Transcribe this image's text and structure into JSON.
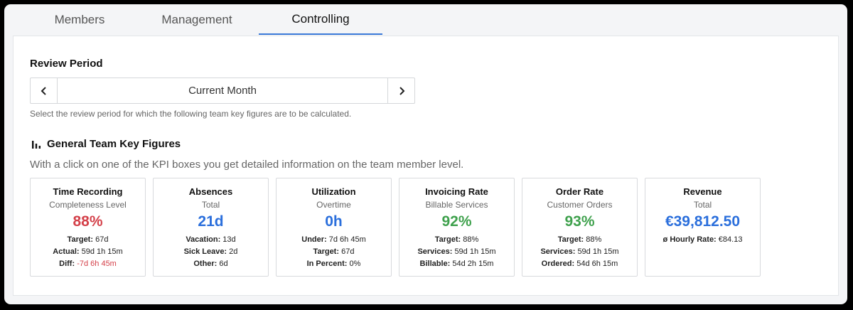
{
  "tabs": [
    {
      "label": "Members",
      "active": false
    },
    {
      "label": "Management",
      "active": false
    },
    {
      "label": "Controlling",
      "active": true
    }
  ],
  "review_period": {
    "title": "Review Period",
    "value": "Current Month",
    "help": "Select the review period for which the following team key figures are to be calculated."
  },
  "kpi": {
    "title": "General Team Key Figures",
    "description": "With a click on one of the KPI boxes you get detailed information on the team member level.",
    "cards": [
      {
        "title": "Time Recording",
        "subtitle": "Completeness Level",
        "value": "88%",
        "color": "#d4414a",
        "lines": [
          {
            "label": "Target:",
            "value": "67d"
          },
          {
            "label": "Actual:",
            "value": "59d 1h 15m"
          },
          {
            "label": "Diff:",
            "value": "-7d 6h 45m"
          }
        ]
      },
      {
        "title": "Absences",
        "subtitle": "Total",
        "value": "21d",
        "color": "#2b6fdc",
        "lines": [
          {
            "label": "Vacation:",
            "value": "13d"
          },
          {
            "label": "Sick Leave:",
            "value": "2d"
          },
          {
            "label": "Other:",
            "value": "6d"
          }
        ]
      },
      {
        "title": "Utilization",
        "subtitle": "Overtime",
        "value": "0h",
        "color": "#2b6fdc",
        "lines": [
          {
            "label": "Under:",
            "value": "7d 6h 45m"
          },
          {
            "label": "Target:",
            "value": "67d"
          },
          {
            "label": "In Percent:",
            "value": "0%"
          }
        ]
      },
      {
        "title": "Invoicing Rate",
        "subtitle": "Billable Services",
        "value": "92%",
        "color": "#3fa14d",
        "lines": [
          {
            "label": "Target:",
            "value": "88%"
          },
          {
            "label": "Services:",
            "value": "59d 1h 15m"
          },
          {
            "label": "Billable:",
            "value": "54d 2h 15m"
          }
        ]
      },
      {
        "title": "Order Rate",
        "subtitle": "Customer Orders",
        "value": "93%",
        "color": "#3fa14d",
        "lines": [
          {
            "label": "Target:",
            "value": "88%"
          },
          {
            "label": "Services:",
            "value": "59d 1h 15m"
          },
          {
            "label": "Ordered:",
            "value": "54d 6h 15m"
          }
        ]
      },
      {
        "title": "Revenue",
        "subtitle": "Total",
        "value": "€39,812.50",
        "color": "#2b6fdc",
        "lines": [
          {
            "label": "ø Hourly Rate:",
            "value": "€84.13"
          }
        ]
      }
    ]
  },
  "colors": {
    "accent": "#3a79d8",
    "negative": "#d4414a"
  }
}
